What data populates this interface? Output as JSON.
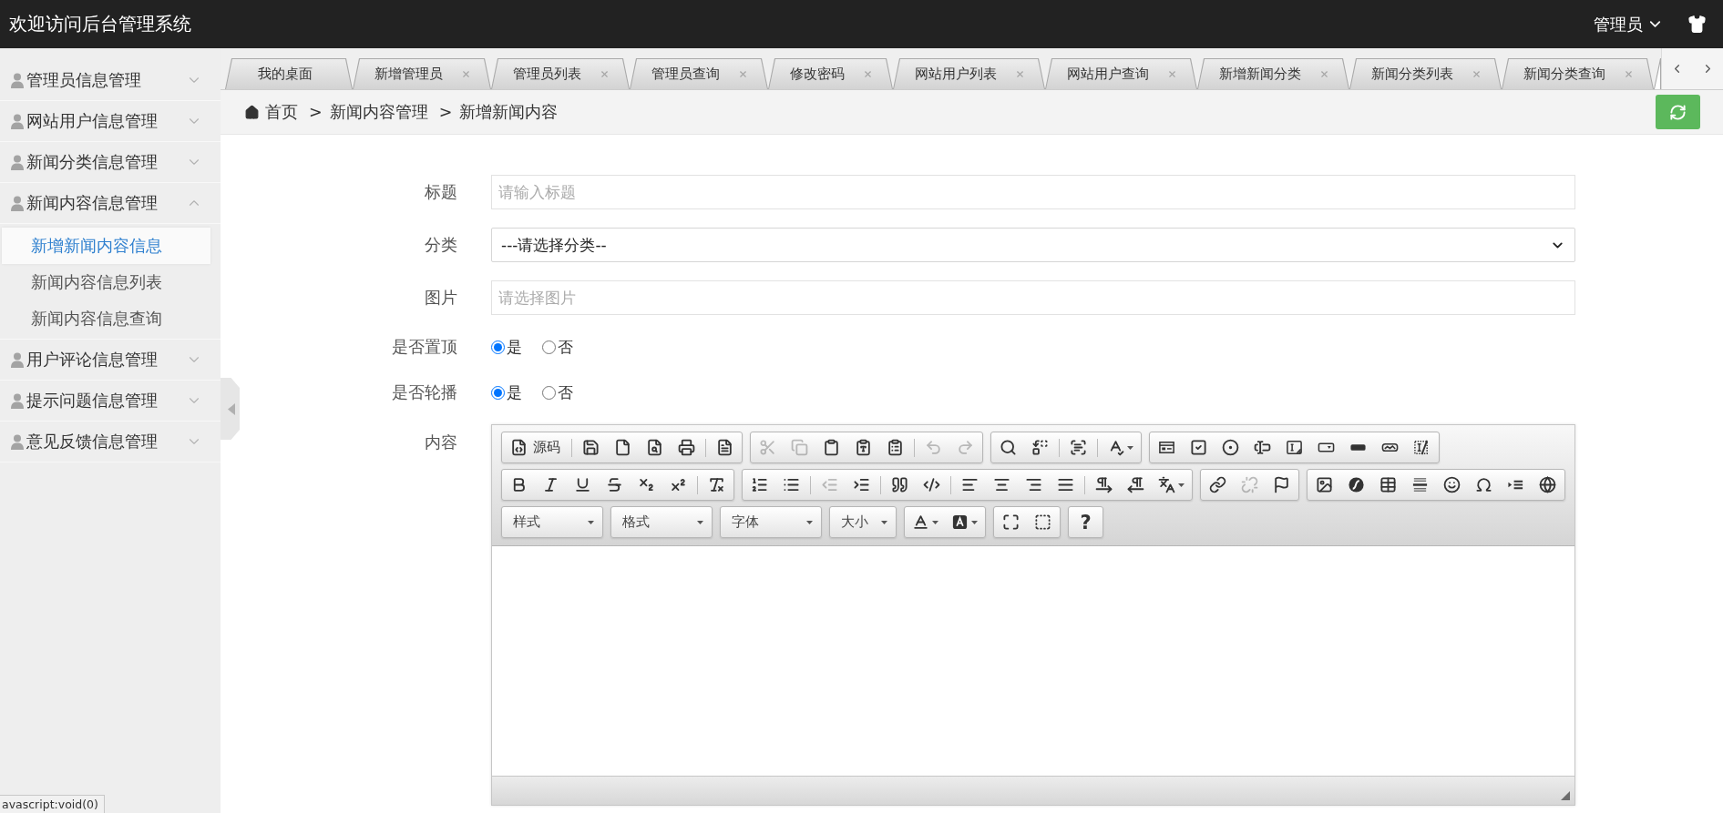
{
  "header": {
    "title": "欢迎访问后台管理系统",
    "user": "管理员"
  },
  "sidebar": {
    "items": [
      {
        "label": "管理员信息管理",
        "expanded": false
      },
      {
        "label": "网站用户信息管理",
        "expanded": false
      },
      {
        "label": "新闻分类信息管理",
        "expanded": false
      },
      {
        "label": "新闻内容信息管理",
        "expanded": true,
        "children": [
          {
            "label": "新增新闻内容信息",
            "selected": true
          },
          {
            "label": "新闻内容信息列表",
            "selected": false
          },
          {
            "label": "新闻内容信息查询",
            "selected": false
          }
        ]
      },
      {
        "label": "用户评论信息管理",
        "expanded": false
      },
      {
        "label": "提示问题信息管理",
        "expanded": false
      },
      {
        "label": "意见反馈信息管理",
        "expanded": false
      }
    ]
  },
  "tabs": [
    {
      "label": "我的桌面",
      "closable": false,
      "selected": false
    },
    {
      "label": "新增管理员",
      "closable": true,
      "selected": false
    },
    {
      "label": "管理员列表",
      "closable": true,
      "selected": false
    },
    {
      "label": "管理员查询",
      "closable": true,
      "selected": false
    },
    {
      "label": "修改密码",
      "closable": true,
      "selected": false
    },
    {
      "label": "网站用户列表",
      "closable": true,
      "selected": false
    },
    {
      "label": "网站用户查询",
      "closable": true,
      "selected": false
    },
    {
      "label": "新增新闻分类",
      "closable": true,
      "selected": false
    },
    {
      "label": "新闻分类列表",
      "closable": true,
      "selected": false
    },
    {
      "label": "新闻分类查询",
      "closable": true,
      "selected": false
    },
    {
      "selected": true
    }
  ],
  "breadcrumb": [
    {
      "label": "首页"
    },
    {
      "separator": ">",
      "label": "新闻内容管理"
    },
    {
      "separator": ">",
      "label": "新增新闻内容"
    }
  ],
  "form": {
    "fields": [
      {
        "kind": "text",
        "label": "标题",
        "placeholder": "请输入标题"
      },
      {
        "kind": "select",
        "label": "分类",
        "value": "---请选择分类--"
      },
      {
        "kind": "text",
        "label": "图片",
        "placeholder": "请选择图片"
      },
      {
        "kind": "radio",
        "label": "是否置顶",
        "options": [
          {
            "label": "是",
            "selected": true
          },
          {
            "label": "否",
            "selected": false
          }
        ]
      },
      {
        "kind": "radio",
        "label": "是否轮播",
        "options": [
          {
            "label": "是",
            "selected": true
          },
          {
            "label": "否",
            "selected": false
          }
        ]
      },
      {
        "kind": "editor",
        "label": "内容",
        "toolbar_rows": [
          {
            "groups": [
              {
                "items": [
                  {
                    "kind": "text_button",
                    "label": "源码",
                    "disabled": false
                  },
                  {
                    "kind": "separator"
                  },
                  {
                    "kind": "button",
                    "disabled": false
                  },
                  {
                    "kind": "button",
                    "disabled": false
                  },
                  {
                    "kind": "button",
                    "disabled": false
                  },
                  {
                    "kind": "button",
                    "disabled": false
                  },
                  {
                    "kind": "separator"
                  },
                  {
                    "kind": "button",
                    "disabled": false
                  }
                ]
              },
              {
                "items": [
                  {
                    "kind": "button",
                    "disabled": true
                  },
                  {
                    "kind": "button",
                    "disabled": true
                  },
                  {
                    "kind": "button",
                    "disabled": false
                  },
                  {
                    "kind": "button",
                    "disabled": false
                  },
                  {
                    "kind": "button",
                    "disabled": false
                  },
                  {
                    "kind": "separator"
                  },
                  {
                    "kind": "button",
                    "disabled": true
                  },
                  {
                    "kind": "button",
                    "disabled": true
                  }
                ]
              },
              {
                "items": [
                  {
                    "kind": "button",
                    "disabled": false
                  },
                  {
                    "kind": "button",
                    "disabled": false
                  },
                  {
                    "kind": "separator"
                  },
                  {
                    "kind": "button",
                    "disabled": false
                  },
                  {
                    "kind": "separator"
                  },
                  {
                    "kind": "menu_button",
                    "disabled": false
                  }
                ]
              },
              {
                "items": [
                  {
                    "kind": "button",
                    "disabled": false
                  },
                  {
                    "kind": "button",
                    "disabled": false
                  },
                  {
                    "kind": "button",
                    "disabled": false
                  },
                  {
                    "kind": "button",
                    "disabled": false
                  },
                  {
                    "kind": "button",
                    "disabled": false
                  },
                  {
                    "kind": "button",
                    "disabled": false
                  },
                  {
                    "kind": "button",
                    "disabled": false
                  },
                  {
                    "kind": "button",
                    "disabled": false
                  },
                  {
                    "kind": "button",
                    "disabled": false
                  }
                ]
              }
            ]
          },
          {
            "groups": [
              {
                "items": [
                  {
                    "kind": "button",
                    "disabled": false
                  },
                  {
                    "kind": "button",
                    "disabled": false
                  },
                  {
                    "kind": "button",
                    "disabled": false
                  },
                  {
                    "kind": "button",
                    "disabled": false
                  },
                  {
                    "kind": "button",
                    "disabled": false
                  },
                  {
                    "kind": "button",
                    "disabled": false
                  },
                  {
                    "kind": "separator"
                  },
                  {
                    "kind": "button",
                    "disabled": false
                  }
                ]
              },
              {
                "items": [
                  {
                    "kind": "button",
                    "disabled": false
                  },
                  {
                    "kind": "button",
                    "disabled": false
                  },
                  {
                    "kind": "separator"
                  },
                  {
                    "kind": "button",
                    "disabled": true
                  },
                  {
                    "kind": "button",
                    "disabled": false
                  },
                  {
                    "kind": "separator"
                  },
                  {
                    "kind": "button",
                    "disabled": false
                  },
                  {
                    "kind": "button",
                    "disabled": false
                  },
                  {
                    "kind": "separator"
                  },
                  {
                    "kind": "button",
                    "disabled": false
                  },
                  {
                    "kind": "button",
                    "disabled": false
                  },
                  {
                    "kind": "button",
                    "disabled": false
                  },
                  {
                    "kind": "button",
                    "disabled": false
                  },
                  {
                    "kind": "separator"
                  },
                  {
                    "kind": "button",
                    "disabled": false
                  },
                  {
                    "kind": "button",
                    "disabled": false
                  },
                  {
                    "kind": "menu_button",
                    "disabled": false
                  }
                ]
              },
              {
                "items": [
                  {
                    "kind": "button",
                    "disabled": false
                  },
                  {
                    "kind": "button",
                    "disabled": true
                  },
                  {
                    "kind": "button",
                    "disabled": false
                  }
                ]
              },
              {
                "items": [
                  {
                    "kind": "button",
                    "disabled": false
                  },
                  {
                    "kind": "button",
                    "disabled": false
                  },
                  {
                    "kind": "button",
                    "disabled": false
                  },
                  {
                    "kind": "button",
                    "disabled": false
                  },
                  {
                    "kind": "button",
                    "disabled": false
                  },
                  {
                    "kind": "button",
                    "disabled": false
                  },
                  {
                    "kind": "button",
                    "disabled": false
                  },
                  {
                    "kind": "button",
                    "disabled": false
                  }
                ]
              }
            ]
          },
          {
            "groups": [
              {
                "items": [
                  {
                    "kind": "combo",
                    "label": "样式"
                  },
                  {
                    "kind": "combo",
                    "label": "格式"
                  },
                  {
                    "kind": "combo",
                    "label": "字体"
                  },
                  {
                    "kind": "combo",
                    "label": "大小"
                  }
                ]
              },
              {
                "items": [
                  {
                    "kind": "menu_button",
                    "disabled": false
                  },
                  {
                    "kind": "menu_button",
                    "disabled": false
                  }
                ]
              },
              {
                "items": [
                  {
                    "kind": "button",
                    "disabled": false
                  },
                  {
                    "kind": "button",
                    "disabled": false
                  }
                ]
              },
              {
                "items": [
                  {
                    "kind": "glyph_button",
                    "label": "?",
                    "disabled": false
                  }
                ]
              }
            ]
          }
        ]
      }
    ]
  },
  "status_bar": {
    "text": "avascript:void(0)"
  }
}
